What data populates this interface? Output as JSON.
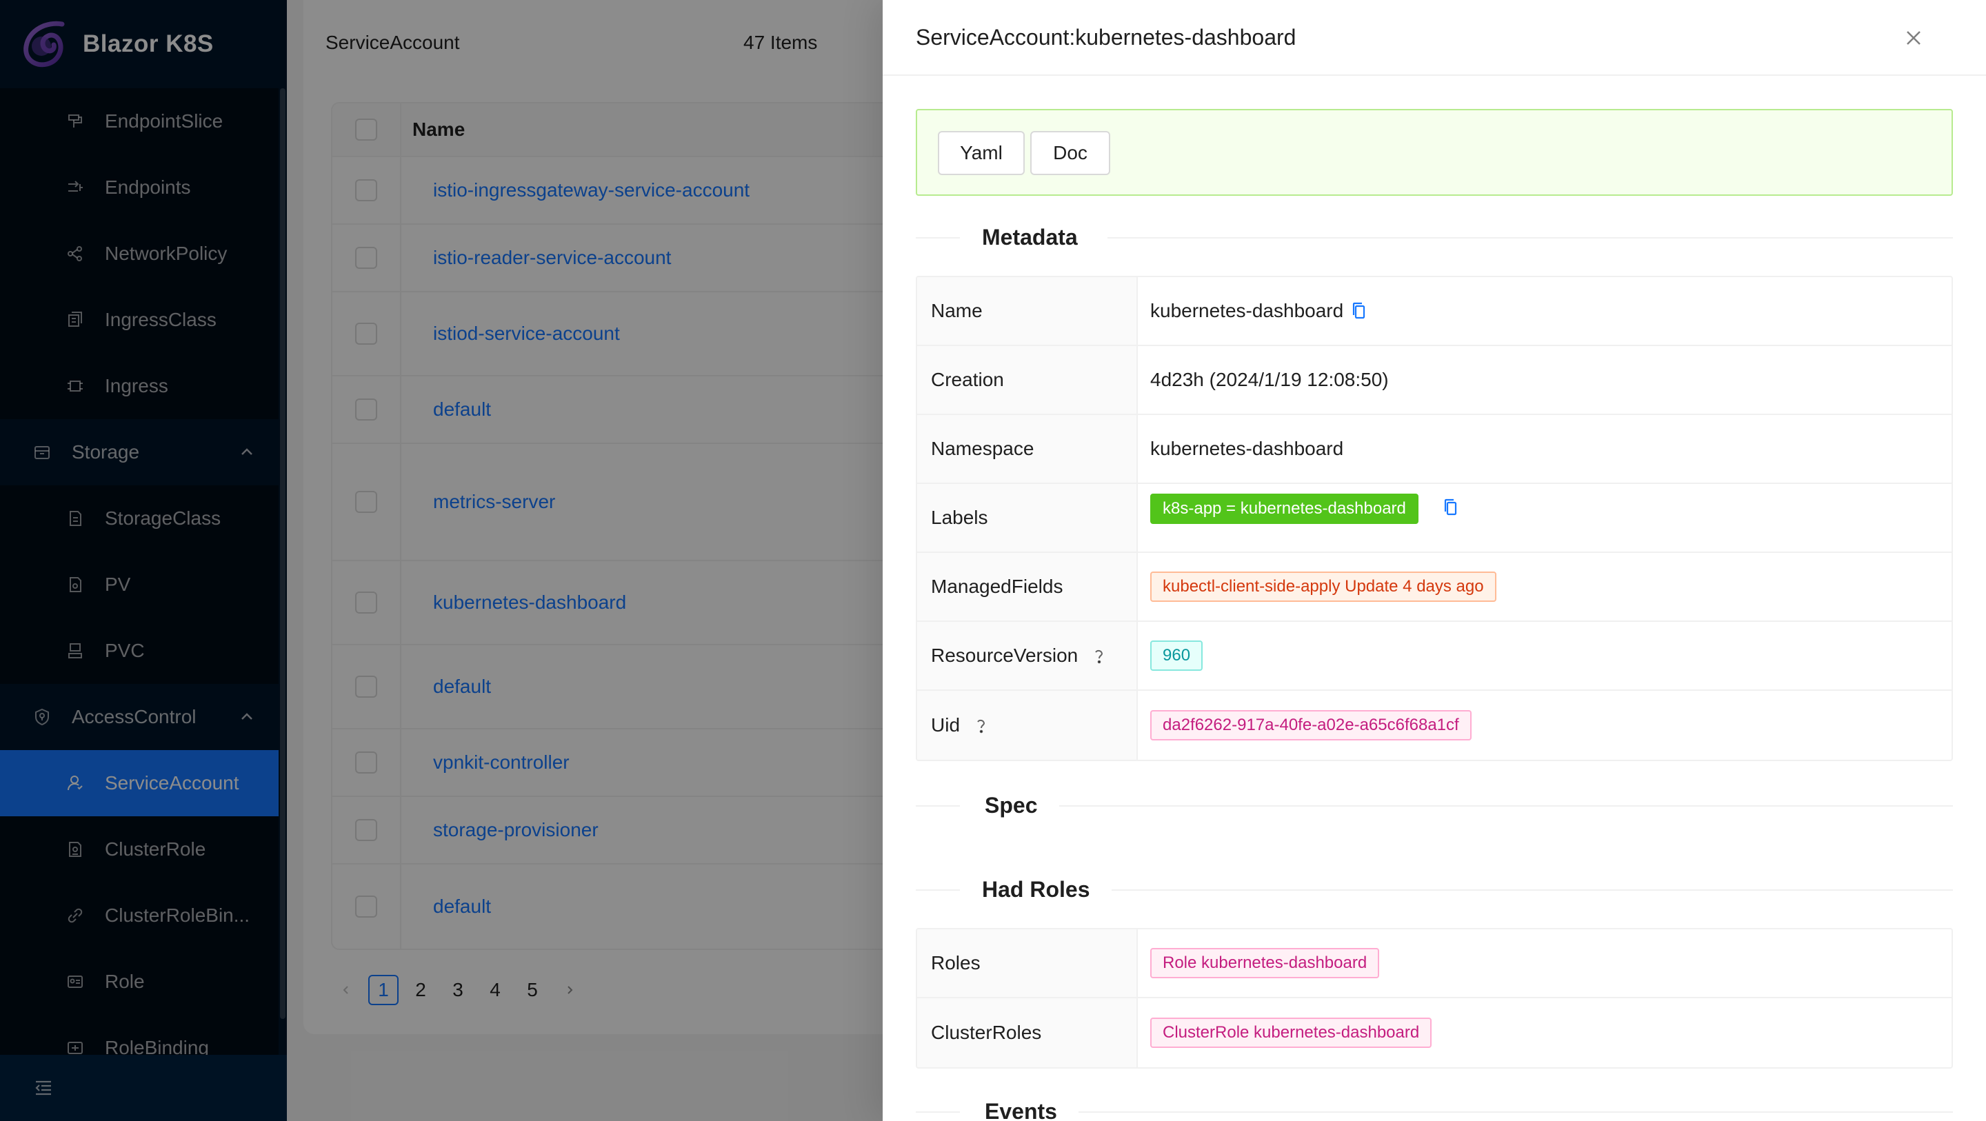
{
  "app": {
    "title": "Blazor K8S"
  },
  "sidebar": {
    "items": [
      {
        "label": "EndpointSlice",
        "icon": "endpointslice-icon"
      },
      {
        "label": "Endpoints",
        "icon": "endpoints-icon"
      },
      {
        "label": "NetworkPolicy",
        "icon": "networkpolicy-icon"
      },
      {
        "label": "IngressClass",
        "icon": "ingressclass-icon"
      },
      {
        "label": "Ingress",
        "icon": "ingress-icon"
      }
    ],
    "storage_group": {
      "label": "Storage",
      "icon": "storage-icon",
      "expanded": true
    },
    "storage_items": [
      {
        "label": "StorageClass",
        "icon": "storageclass-icon"
      },
      {
        "label": "PV",
        "icon": "pv-icon"
      },
      {
        "label": "PVC",
        "icon": "pvc-icon"
      }
    ],
    "access_group": {
      "label": "AccessControl",
      "icon": "accesscontrol-icon",
      "expanded": true
    },
    "access_items": [
      {
        "label": "ServiceAccount",
        "icon": "serviceaccount-icon",
        "selected": true
      },
      {
        "label": "ClusterRole",
        "icon": "clusterrole-icon"
      },
      {
        "label": "ClusterRoleBin...",
        "icon": "clusterrolebinding-icon"
      },
      {
        "label": "Role",
        "icon": "role-icon"
      },
      {
        "label": "RoleBinding",
        "icon": "rolebinding-icon"
      }
    ],
    "collapse_icon": "menu-fold-icon"
  },
  "list": {
    "title": "ServiceAccount",
    "count": "47 Items",
    "column_name": "Name",
    "rows": [
      "istio-ingressgateway-service-account",
      "istio-reader-service-account",
      "istiod-service-account",
      "default",
      "metrics-server",
      "kubernetes-dashboard",
      "default",
      "vpnkit-controller",
      "storage-provisioner",
      "default"
    ],
    "pages": [
      "1",
      "2",
      "3",
      "4",
      "5"
    ],
    "current_page": "1"
  },
  "drawer": {
    "title": "ServiceAccount:kubernetes-dashboard",
    "buttons": {
      "yaml": "Yaml",
      "doc": "Doc"
    },
    "sections": {
      "metadata": "Metadata",
      "spec": "Spec",
      "roles": "Had Roles",
      "events": "Events"
    },
    "metadata": {
      "name_label": "Name",
      "name": "kubernetes-dashboard",
      "creation_label": "Creation",
      "creation": "4d23h (2024/1/19 12:08:50)",
      "namespace_label": "Namespace",
      "namespace": "kubernetes-dashboard",
      "labels_label": "Labels",
      "labels": "k8s-app = kubernetes-dashboard",
      "managed_label": "ManagedFields",
      "managed": "kubectl-client-side-apply Update 4 days ago",
      "rv_label": "ResourceVersion",
      "rv": "960",
      "uid_label": "Uid",
      "uid": "da2f6262-917a-40fe-a02e-a65c6f68a1cf"
    },
    "roles": {
      "roles_label": "Roles",
      "roles": "Role kubernetes-dashboard",
      "clusterroles_label": "ClusterRoles",
      "clusterroles": "ClusterRole kubernetes-dashboard"
    }
  },
  "colors": {
    "sidebar_bg": "#001529",
    "accent": "#1677ff",
    "success_bg": "#f6ffed",
    "label_tag": "#52c41a"
  }
}
